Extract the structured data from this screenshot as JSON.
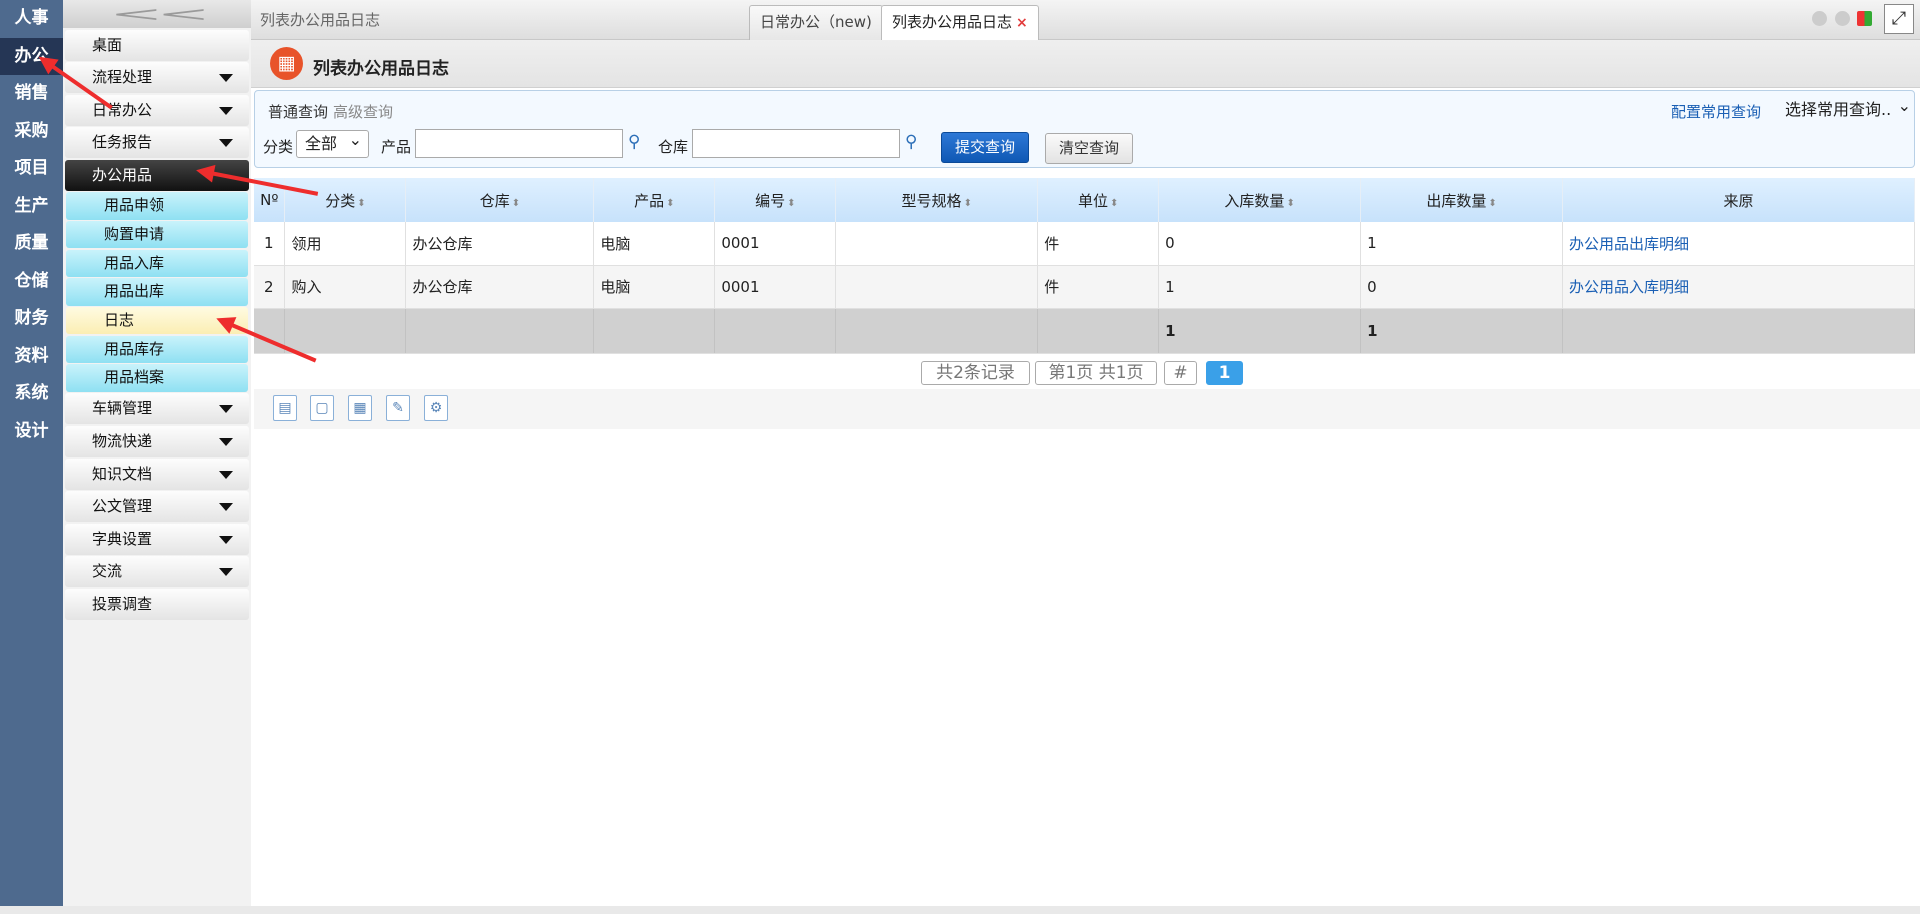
{
  "modules": [
    "人事",
    "办公",
    "销售",
    "采购",
    "项目",
    "生产",
    "质量",
    "仓储",
    "财务",
    "资料",
    "系统",
    "设计"
  ],
  "sidebar": {
    "collapse_glyph": "<<",
    "items": [
      {
        "label": "桌面"
      },
      {
        "label": "流程处理"
      },
      {
        "label": "日常办公"
      },
      {
        "label": "任务报告"
      },
      {
        "label": "办公用品"
      },
      {
        "label": "车辆管理"
      },
      {
        "label": "物流快递"
      },
      {
        "label": "知识文档"
      },
      {
        "label": "公文管理"
      },
      {
        "label": "字典设置"
      },
      {
        "label": "交流"
      },
      {
        "label": "投票调查"
      }
    ],
    "sub_items": [
      "用品申领",
      "购置申请",
      "用品入库",
      "用品出库",
      "日志",
      "用品库存",
      "用品档案"
    ]
  },
  "tabbar": {
    "crumb": "列表办公用品日志",
    "tabs": [
      {
        "label": "日常办公（new)"
      },
      {
        "label": "列表办公用品日志",
        "close": "×"
      }
    ],
    "expand_glyph": "⤢"
  },
  "page": {
    "title": "列表办公用品日志",
    "icon_glyph": "▦"
  },
  "query": {
    "tab_normal": "普通查询",
    "tab_advanced": "高级查询",
    "category_label": "分类",
    "category_value": "全部",
    "product_label": "产品",
    "warehouse_label": "仓库",
    "submit": "提交查询",
    "clear": "清空查询",
    "config_link": "配置常用查询",
    "common_select": "选择常用查询.."
  },
  "table": {
    "headers": [
      "Nº",
      "分类",
      "仓库",
      "产品",
      "编号",
      "型号规格",
      "单位",
      "入库数量",
      "出库数量",
      "来原"
    ],
    "rows": [
      [
        "1",
        "领用",
        "办公仓库",
        "电脑",
        "0001",
        "",
        "件",
        "0",
        "1",
        "办公用品出库明细"
      ],
      [
        "2",
        "购入",
        "办公仓库",
        "电脑",
        "0001",
        "",
        "件",
        "1",
        "0",
        "办公用品入库明细"
      ]
    ],
    "footer": {
      "in_total": "1",
      "out_total": "1"
    }
  },
  "pager": {
    "records": "共2条记录",
    "pages": "第1页 共1页",
    "hash": "#",
    "current": "1"
  },
  "colors": {
    "module_bg": "#4e6a8e",
    "module_active": "#253655",
    "submenu": "#8fe0f2",
    "accent": "#1a5fb4",
    "arrow": "#ee2d2d"
  }
}
